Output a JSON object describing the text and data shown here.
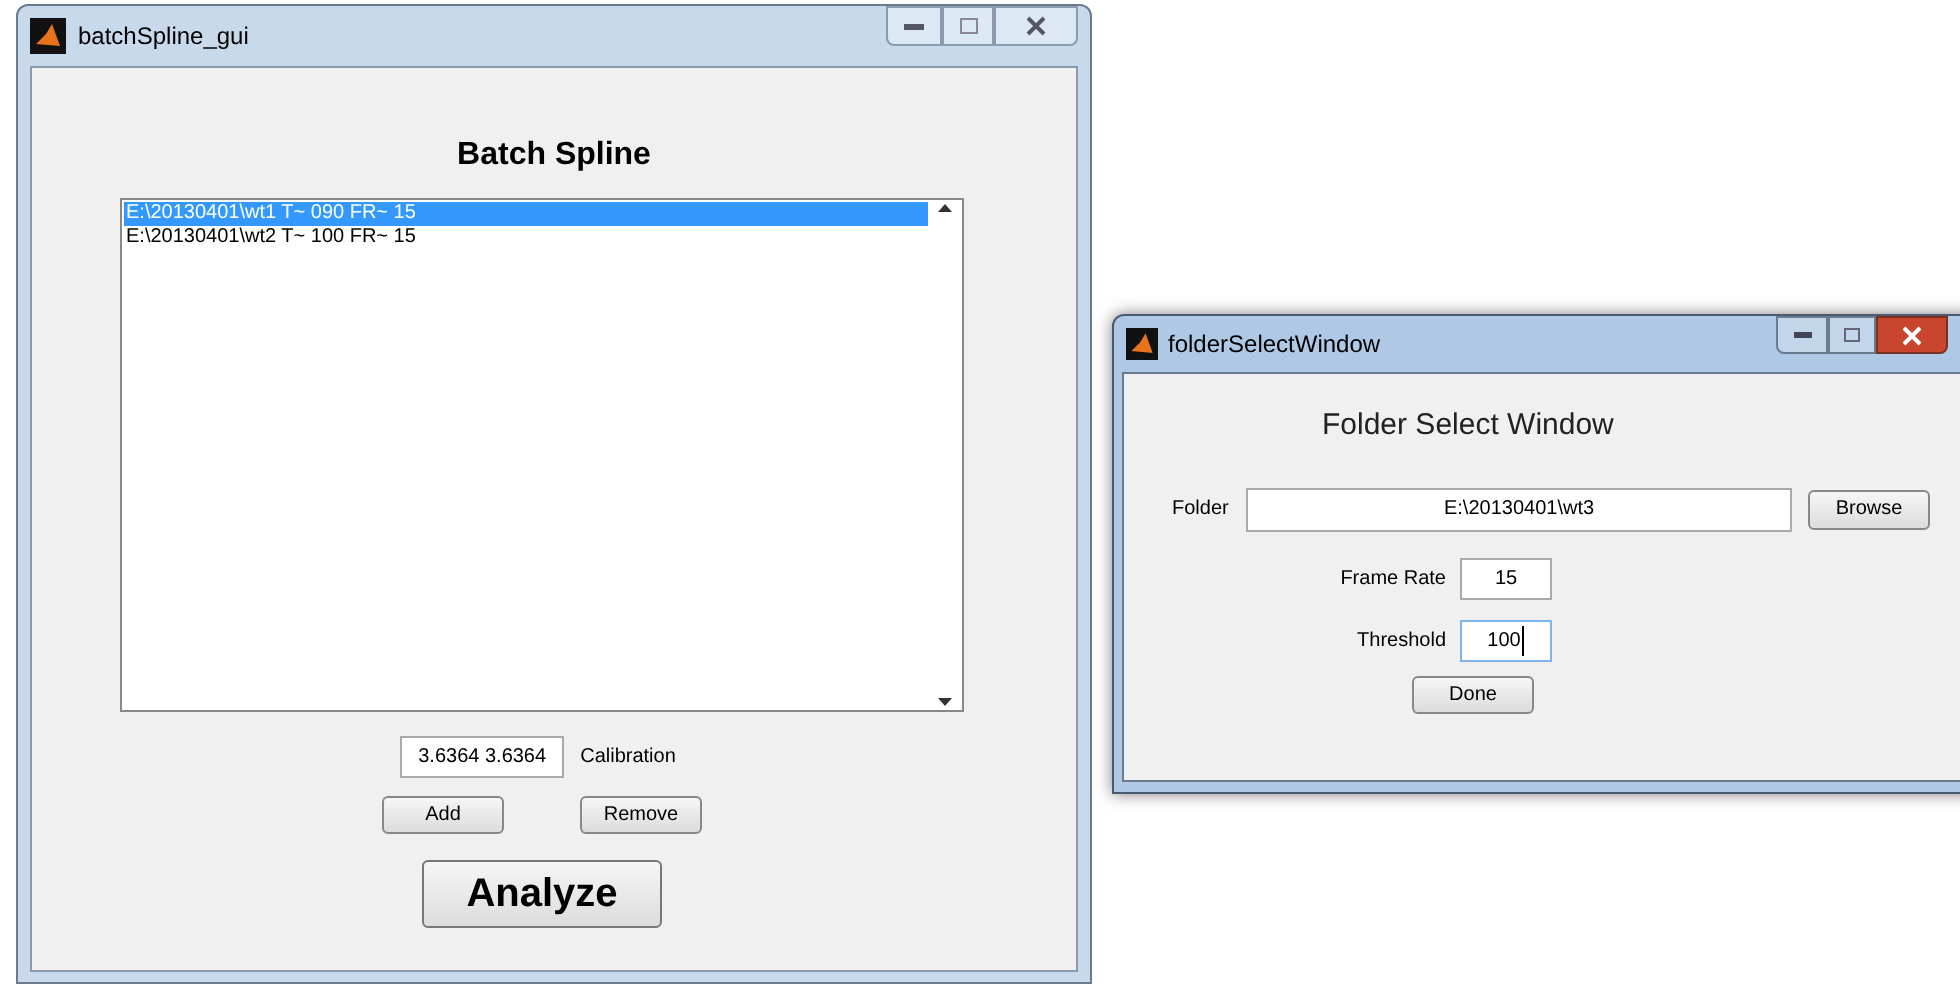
{
  "main_window": {
    "title": "batchSpline_gui",
    "heading": "Batch Spline",
    "list": [
      {
        "text": "E:\\20130401\\wt1 T~ 090 FR~ 15",
        "selected": true
      },
      {
        "text": "E:\\20130401\\wt2 T~ 100 FR~ 15",
        "selected": false
      }
    ],
    "calibration": {
      "value": "3.6364 3.6364",
      "label": "Calibration"
    },
    "buttons": [
      "Add",
      "Remove"
    ],
    "analyze_button": "Analyze"
  },
  "folder_window": {
    "title": "folderSelectWindow",
    "heading": "Folder Select Window",
    "folder": {
      "label": "Folder",
      "value": "E:\\20130401\\wt3"
    },
    "browse_button": "Browse",
    "fields": [
      {
        "label": "Frame Rate",
        "value": "15",
        "focused": false
      },
      {
        "label": "Threshold",
        "value": "100",
        "focused": true
      }
    ],
    "done_button": "Done"
  }
}
